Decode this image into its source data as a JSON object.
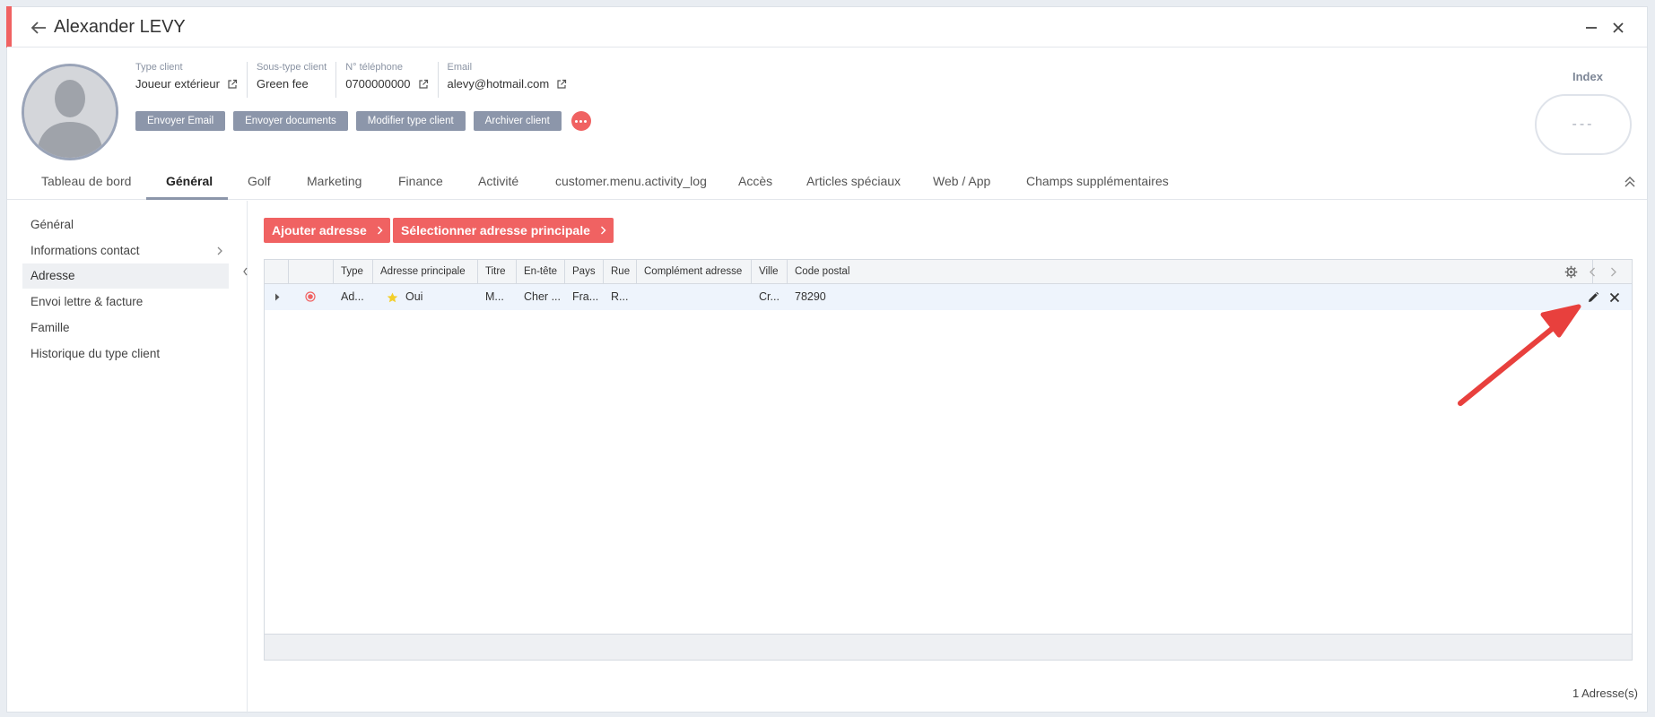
{
  "window": {
    "title": "Alexander LEVY"
  },
  "profile": {
    "fields": [
      {
        "label": "Type client",
        "value": "Joueur extérieur"
      },
      {
        "label": "Sous-type client",
        "value": "Green fee"
      },
      {
        "label": "N° téléphone",
        "value": "0700000000"
      },
      {
        "label": "Email",
        "value": "alevy@hotmail.com"
      }
    ],
    "actions": [
      "Envoyer Email",
      "Envoyer documents",
      "Modifier type client",
      "Archiver client"
    ],
    "index": {
      "label": "Index",
      "value": "---"
    }
  },
  "tabs": [
    "Tableau de bord",
    "Général",
    "Golf",
    "Marketing",
    "Finance",
    "Activité",
    "customer.menu.activity_log",
    "Accès",
    "Articles spéciaux",
    "Web / App",
    "Champs supplémentaires"
  ],
  "active_tab": "Général",
  "sidebar": {
    "items": [
      "Général",
      "Informations contact",
      "Adresse",
      "Envoi lettre & facture",
      "Famille",
      "Historique du type client"
    ],
    "active": "Adresse"
  },
  "toolbar": {
    "add_label": "Ajouter adresse",
    "select_main_label": "Sélectionner adresse principale"
  },
  "grid": {
    "columns": [
      "Type",
      "Adresse principale",
      "Titre",
      "En-tête",
      "Pays",
      "Rue",
      "Complément adresse",
      "Ville",
      "Code postal"
    ],
    "rows": [
      {
        "type": "Ad...",
        "principale": "Oui",
        "titre": "M...",
        "entete": "Cher ...",
        "pays": "Fra...",
        "rue": "R...",
        "complement": "",
        "ville": "Cr...",
        "code_postal": "78290"
      }
    ]
  },
  "footer": {
    "count_label": "1 Adresse(s)"
  },
  "colors": {
    "accent": "#f06262",
    "secondary_button": "#8c96aa",
    "row_highlight": "#eef4fc",
    "annotation_arrow": "#e8403d"
  }
}
